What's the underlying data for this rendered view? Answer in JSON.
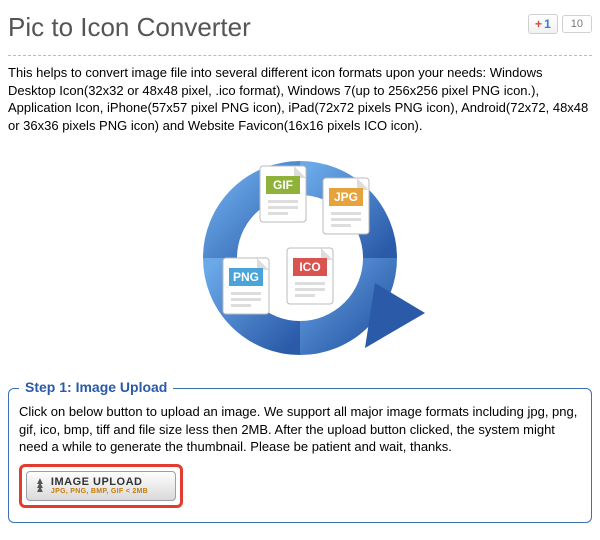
{
  "header": {
    "title": "Pic to Icon Converter",
    "plusone_label": "+1",
    "plusone_count": "10"
  },
  "description": "This helps to convert image file into several different icon formats upon your needs: Windows Desktop Icon(32x32 or 48x48 pixel, .ico format), Windows 7(up to 256x256 pixel PNG icon.), Application Icon, iPhone(57x57 pixel PNG icon), iPad(72x72 pixels PNG icon), Android(72x72, 48x48 or 36x36 pixels PNG icon) and Website Favicon(16x16 pixels ICO icon).",
  "icons": {
    "gif": "GIF",
    "jpg": "JPG",
    "png": "PNG",
    "ico": "ICO"
  },
  "step1": {
    "legend": "Step 1: Image Upload",
    "desc": "Click on below button to upload an image. We support all major image formats including jpg, png, gif, ico, bmp, tiff and file size less then 2MB. After the upload button clicked, the system might need a while to generate the thumbnail. Please be patient and wait, thanks.",
    "button_label": "IMAGE UPLOAD",
    "button_sub": "JPG, PNG, BMP, GIF < 2MB"
  }
}
